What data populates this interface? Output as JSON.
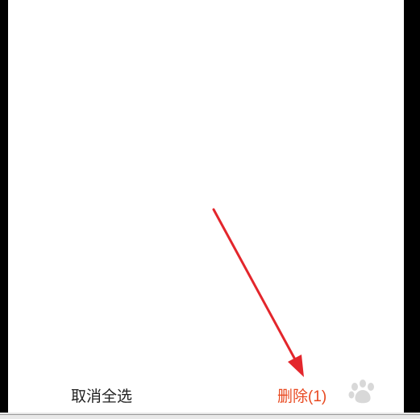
{
  "bottom_bar": {
    "deselect_all_label": "取消全选",
    "delete_label": "删除(1)"
  },
  "colors": {
    "delete_text": "#e8481f",
    "annotation_arrow": "#e3262c"
  }
}
